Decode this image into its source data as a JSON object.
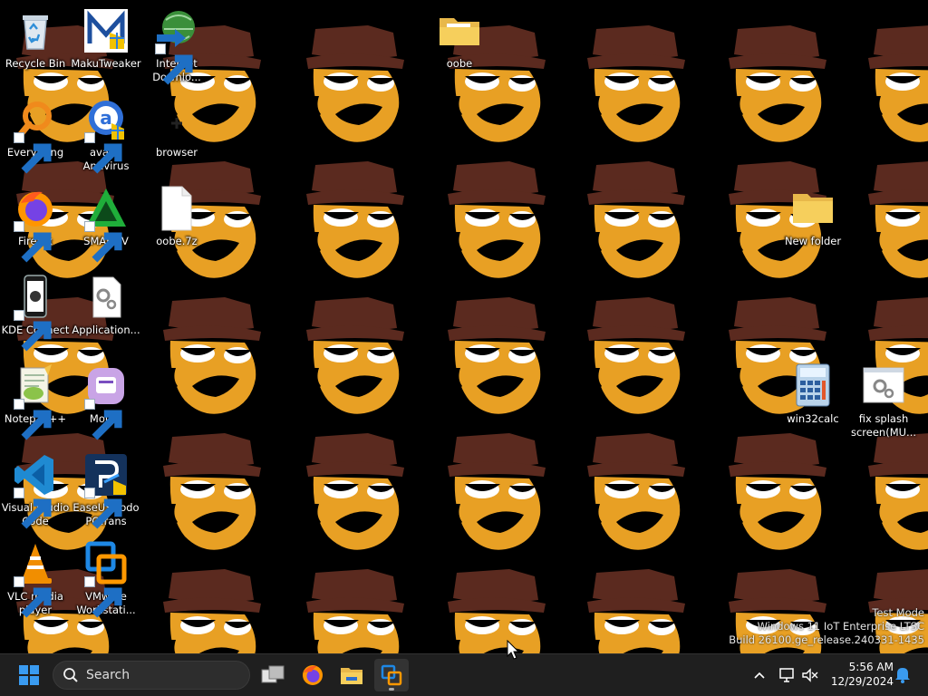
{
  "desktop": {
    "icons": [
      {
        "id": "recycle-bin",
        "label": "Recycle Bin"
      },
      {
        "id": "makutweaker",
        "label": "MakuTweaker"
      },
      {
        "id": "idm",
        "label": "Internet\nDownlo..."
      },
      {
        "id": "oobe-folder",
        "label": "oobe"
      },
      {
        "id": "everything",
        "label": "Everything"
      },
      {
        "id": "avast",
        "label": "avast!\nAntivirus"
      },
      {
        "id": "browser",
        "label": "browser"
      },
      {
        "id": "firefox",
        "label": "Firefox"
      },
      {
        "id": "smadav",
        "label": "SMADΔV"
      },
      {
        "id": "oobe-7z",
        "label": "oobe.7z"
      },
      {
        "id": "new-folder",
        "label": "New folder"
      },
      {
        "id": "kde-connect",
        "label": "KDE Connect"
      },
      {
        "id": "application",
        "label": "Application..."
      },
      {
        "id": "notepadpp",
        "label": "Notepad++"
      },
      {
        "id": "motrix",
        "label": "Motrix"
      },
      {
        "id": "win32calc",
        "label": "win32calc"
      },
      {
        "id": "fix-splash",
        "label": "fix splash\nscreen(MU..."
      },
      {
        "id": "vscode",
        "label": "Visual Studio\nCode"
      },
      {
        "id": "easeus",
        "label": "EaseUS Todo\nPCTrans"
      },
      {
        "id": "vlc",
        "label": "VLC media\nplayer"
      },
      {
        "id": "vmware",
        "label": "VMware\nWorkstati..."
      }
    ]
  },
  "watermark": {
    "line1": "Test Mode",
    "line2": "Windows 11 IoT Enterprise LTSC",
    "line3": "Build 26100.ge_release.240331-1435"
  },
  "taskbar": {
    "search_placeholder": "Search",
    "clock_time": "5:56 AM",
    "clock_date": "12/29/2024",
    "pinned": [
      "start-icon",
      "task-view-icon",
      "firefox-icon",
      "file-explorer-icon",
      "vmware-icon"
    ],
    "active_app": "vmware-icon"
  },
  "colors": {
    "wallpaper_bg": "#000000",
    "hat": "#5b2a1f",
    "face": "#e8a024",
    "taskbar_bg": "#1f1f1f",
    "accent": "#3a8ee6"
  }
}
